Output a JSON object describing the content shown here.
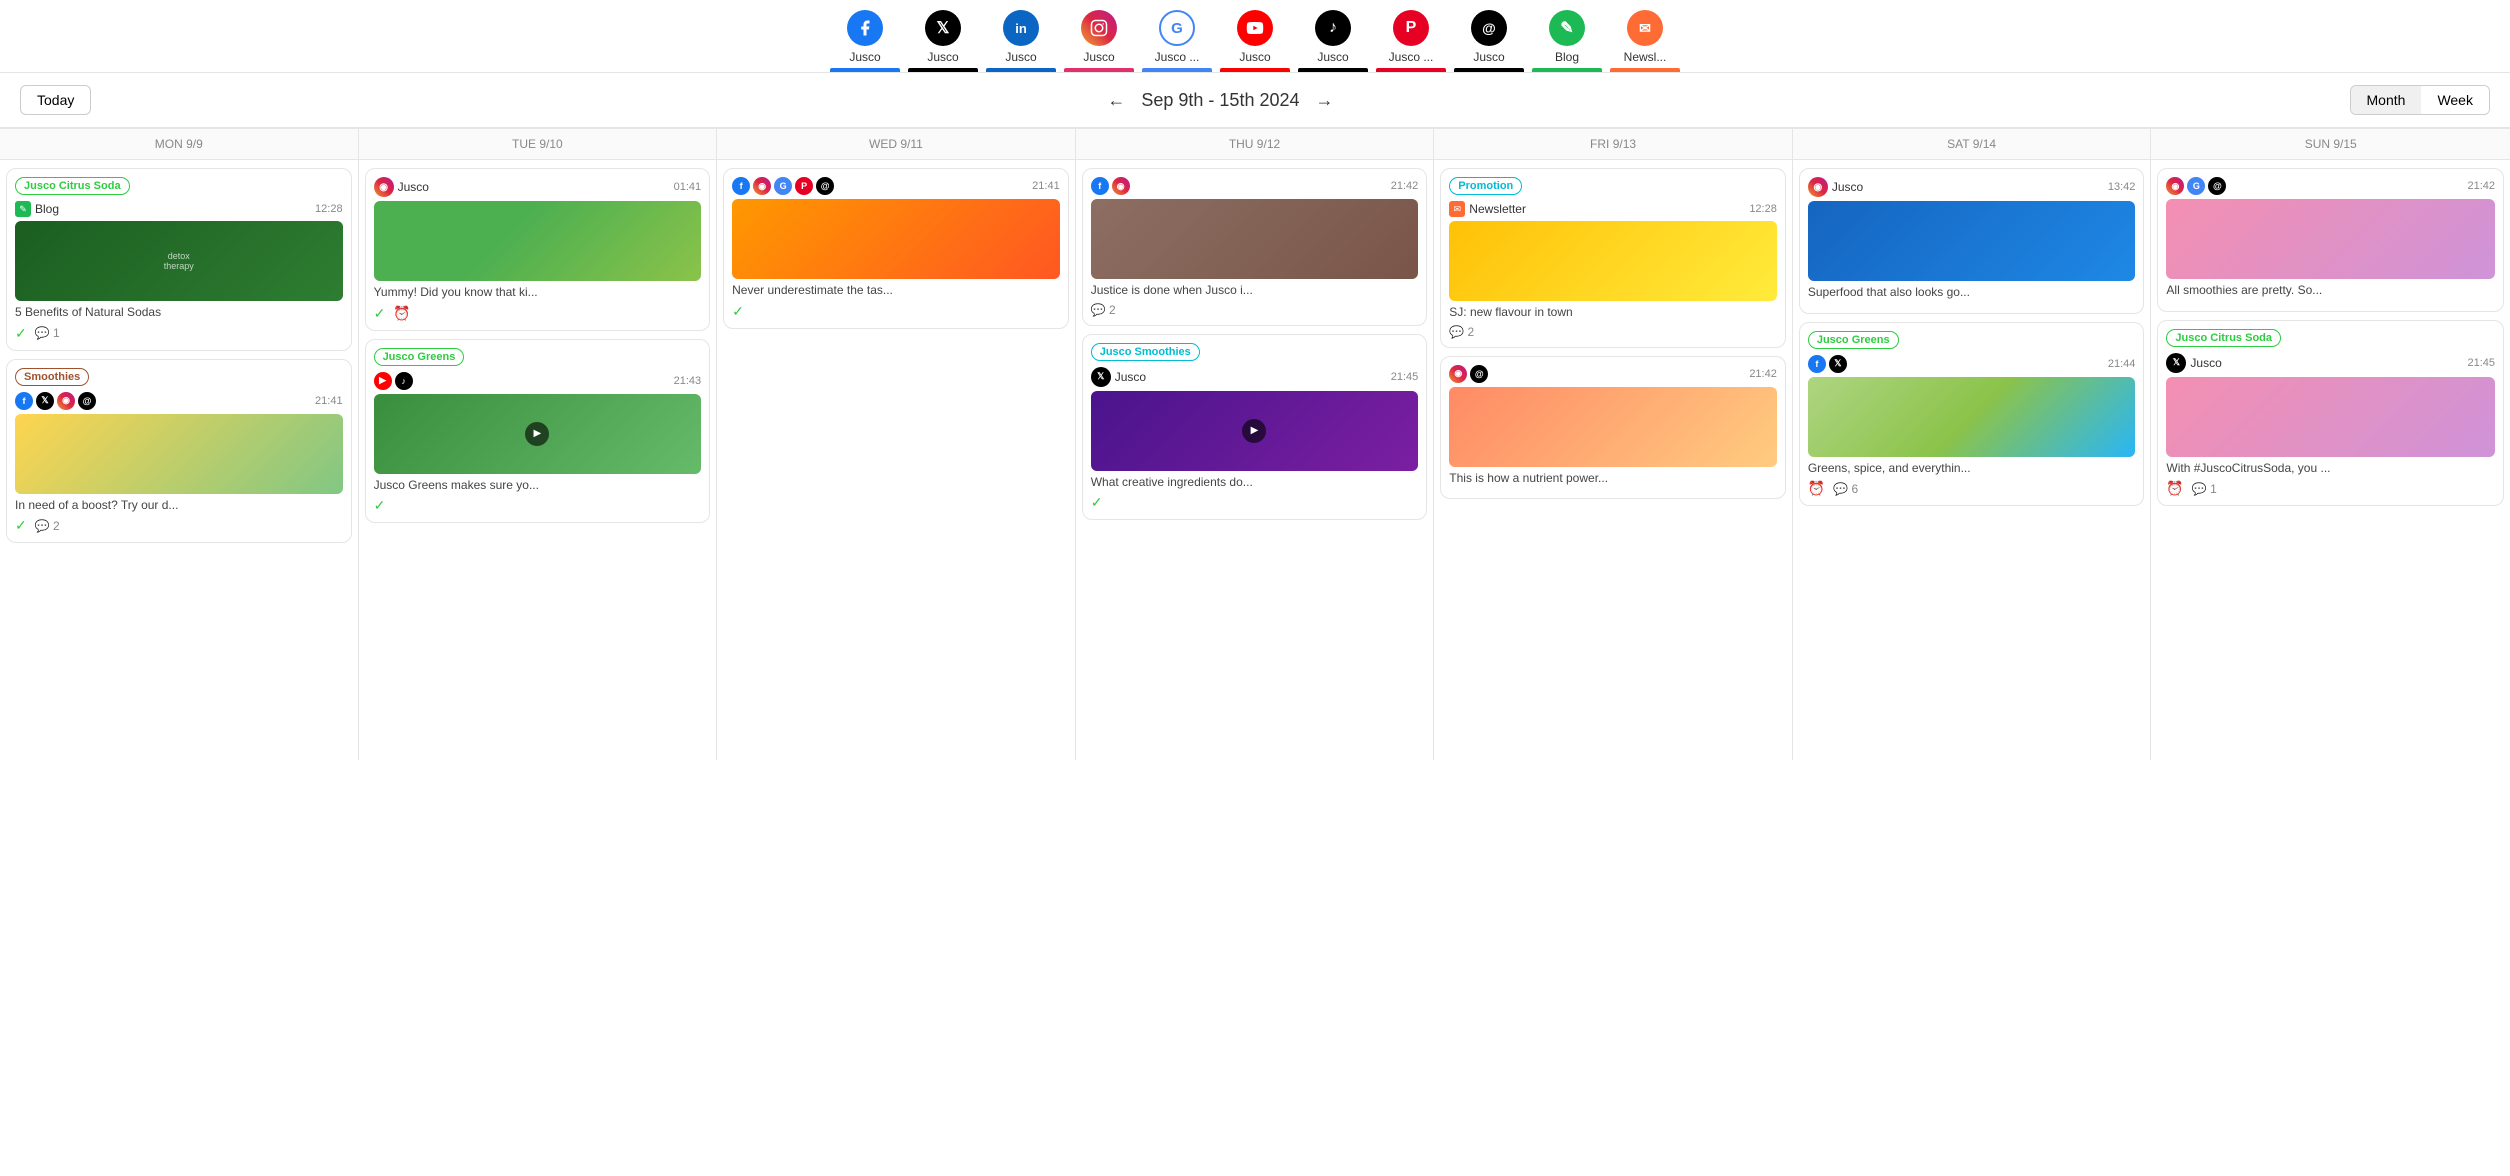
{
  "nav": {
    "items": [
      {
        "label": "Jusco",
        "platform": "facebook",
        "icon": "f",
        "barColor": "#1877F2"
      },
      {
        "label": "Jusco",
        "platform": "twitter",
        "icon": "𝕏",
        "barColor": "#000"
      },
      {
        "label": "Jusco",
        "platform": "linkedin",
        "icon": "in",
        "barColor": "#0A66C2"
      },
      {
        "label": "Jusco",
        "platform": "instagram",
        "icon": "◉",
        "barColor": "#E1306C"
      },
      {
        "label": "Jusco ...",
        "platform": "google",
        "icon": "G",
        "barColor": "#4285F4"
      },
      {
        "label": "Jusco",
        "platform": "youtube",
        "icon": "▶",
        "barColor": "#FF0000"
      },
      {
        "label": "Jusco",
        "platform": "tiktok",
        "icon": "♪",
        "barColor": "#000"
      },
      {
        "label": "Jusco ...",
        "platform": "pinterest",
        "icon": "P",
        "barColor": "#E60023"
      },
      {
        "label": "Jusco",
        "platform": "threads",
        "icon": "@",
        "barColor": "#000"
      },
      {
        "label": "Blog",
        "platform": "blog-icon",
        "icon": "✎",
        "barColor": "#1DB954"
      },
      {
        "label": "Newsl...",
        "platform": "newsletter-icon",
        "icon": "✉",
        "barColor": "#FF6B35"
      }
    ]
  },
  "calendar": {
    "today_label": "Today",
    "date_range": "Sep 9th - 15th 2024",
    "view_month": "Month",
    "view_week": "Week",
    "days": [
      {
        "label": "MON 9/9"
      },
      {
        "label": "TUE 9/10"
      },
      {
        "label": "WED 9/11"
      },
      {
        "label": "THU 9/12"
      },
      {
        "label": "FRI 9/13"
      },
      {
        "label": "SAT 9/14"
      },
      {
        "label": "SUN 9/15"
      }
    ]
  },
  "cards": {
    "mon": [
      {
        "tag": "Jusco Citrus Soda",
        "tagClass": "tag-citrus",
        "source": "Blog",
        "sourcePlatform": "blog",
        "time": "12:28",
        "imgClass": "img-herb-dark",
        "hasVideo": false,
        "text": "5 Benefits of Natural Sodas",
        "checks": 1,
        "comments": 1
      },
      {
        "tag": "Smoothies",
        "tagClass": "tag-smoothies",
        "socialIcons": [
          "fb",
          "tw",
          "ig",
          "th"
        ],
        "time": "21:41",
        "imgClass": "img-fresh",
        "hasVideo": false,
        "text": "In need of a boost? Try our d...",
        "checks": 1,
        "comments": 2
      }
    ],
    "tue": [
      {
        "tag": null,
        "source": "Jusco",
        "sourcePlatform": "instagram",
        "time": "01:41",
        "imgClass": "img-kiwi",
        "hasVideo": false,
        "text": "Yummy! Did you know that ki...",
        "checks": 1,
        "hasClock": true
      },
      {
        "tag": "Jusco Greens",
        "tagClass": "tag-greens",
        "sourcePlatform": "youtube-tiktok",
        "time": "21:43",
        "imgClass": "img-avocado",
        "hasVideo": true,
        "text": "Jusco Greens makes sure yo...",
        "checks": 1
      }
    ],
    "wed": [
      {
        "tag": null,
        "socialIcons": [
          "fb",
          "ig",
          "go",
          "pi",
          "th"
        ],
        "time": "21:41",
        "imgClass": "img-orange",
        "hasVideo": false,
        "text": "Never underestimate the tas...",
        "checks": 1
      }
    ],
    "thu": [
      {
        "tag": null,
        "socialIcons": [
          "fb",
          "ig"
        ],
        "time": "21:42",
        "imgClass": "img-cocktail",
        "hasVideo": false,
        "text": "Justice is done when Jusco i...",
        "comments": 2
      },
      {
        "tag": "Jusco Smoothies",
        "tagClass": "tag-juico-smoothies",
        "source": "Jusco",
        "sourcePlatform": "twitter",
        "time": "21:45",
        "imgClass": "img-smoothie-dark",
        "hasVideo": true,
        "text": "What creative ingredients do...",
        "checks": 1
      }
    ],
    "fri": [
      {
        "tag": "Promotion",
        "tagClass": "tag-promotion",
        "source": "Newsletter",
        "sourcePlatform": "newsletter",
        "time": "12:28",
        "imgClass": "img-juice-yellow",
        "hasVideo": false,
        "text": "SJ: new flavour in town",
        "comments": 2
      },
      {
        "tag": null,
        "socialIcons": [
          "ig",
          "th"
        ],
        "time": "21:42",
        "imgClass": "img-peach",
        "hasVideo": false,
        "text": "This is how a nutrient power...",
        "comments": null
      }
    ],
    "sat": [
      {
        "tag": null,
        "source": "Jusco",
        "sourcePlatform": "instagram",
        "time": "13:42",
        "imgClass": "img-blueberry",
        "hasVideo": false,
        "text": "Superfood that also looks go...",
        "checks": null
      },
      {
        "tag": "Jusco Greens",
        "tagClass": "tag-greens",
        "socialIcons": [
          "fb",
          "tw"
        ],
        "time": "21:44",
        "imgClass": "img-lime",
        "hasVideo": false,
        "text": "Greens, spice, and everythin...",
        "hasClock": true,
        "comments": 6
      }
    ],
    "sun": [
      {
        "tag": null,
        "socialIcons": [
          "ig",
          "go",
          "th"
        ],
        "time": "21:42",
        "imgClass": "img-pink-drink",
        "hasVideo": false,
        "text": "All smoothies are pretty. So...",
        "checks": null
      },
      {
        "tag": "Jusco Citrus Soda",
        "tagClass": "tag-citrus-soda",
        "source": "Jusco",
        "sourcePlatform": "twitter",
        "time": "21:45",
        "imgClass": "img-pink-drink",
        "hasVideo": false,
        "text": "With #JuscoCitrusSoda, you ...",
        "hasClock": true,
        "comments": 1
      }
    ]
  }
}
